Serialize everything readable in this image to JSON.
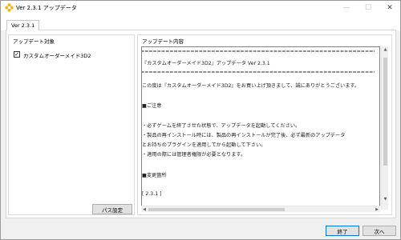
{
  "window": {
    "title": "Ver 2.3.1 アップデータ",
    "controls": {
      "minimize": "—",
      "maximize": "☐",
      "close": "✕"
    }
  },
  "tab": {
    "label": "Ver 2.3.1"
  },
  "left_group": {
    "title": "アップデート対象",
    "item": {
      "label": "カスタムオーダーメイド3D2",
      "checked": true,
      "check_mark": "✓"
    },
    "path_button": "パス設定"
  },
  "right_group": {
    "title": "アップデート内容",
    "lines": [
      "======================================================================",
      "『カスタムオーダーメイド3D2』アップデータ Ver 2.3.1",
      "======================================================================",
      "この度は『カスタムオーダーメイド3D2』をお買い上げ頂きまして、誠にありがとうございます。",
      "■ご注意",
      "・必ずゲームを終了させた状態で、アップデータを起動してください。",
      "・製品の再インストール時には、製品の再インストールが完了後、必ず最新のアップデータ",
      "  とお持ちのプラグインを適用してから起動して下さい。",
      "・適用の際には管理者権限が必要となります。",
      "■変更箇所",
      "[ 2.3.1 ]"
    ]
  },
  "scroll": {
    "up": "▲",
    "down": "▼",
    "left": "◀",
    "right": "▶"
  },
  "footer": {
    "finish": "終了",
    "next": "次へ"
  }
}
